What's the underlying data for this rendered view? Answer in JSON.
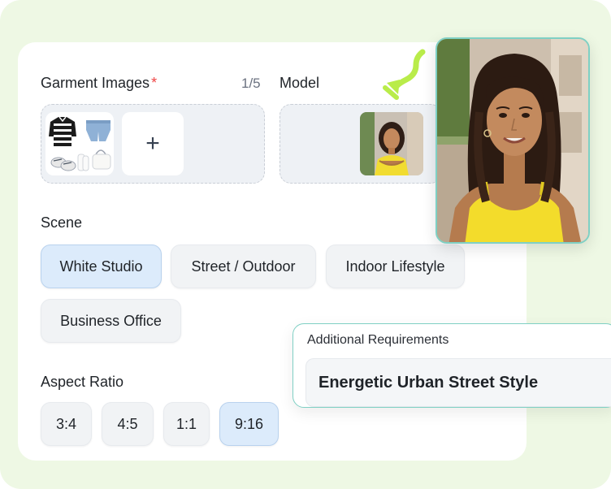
{
  "garment": {
    "label": "Garment Images",
    "required_mark": "*",
    "count": "1/5",
    "add_symbol": "+"
  },
  "model": {
    "label": "Model"
  },
  "scene": {
    "label": "Scene",
    "options": [
      "White Studio",
      "Street / Outdoor",
      "Indoor Lifestyle",
      "Business Office"
    ],
    "selected": "White Studio"
  },
  "aspect": {
    "label": "Aspect Ratio",
    "options": [
      "3:4",
      "4:5",
      "1:1",
      "9:16"
    ],
    "selected": "9:16"
  },
  "requirements": {
    "label": "Additional Requirements",
    "value": "Energetic Urban Street Style"
  },
  "colors": {
    "background_green": "#eef8e4",
    "accent_teal": "#7fd0c4",
    "selected_chip": "#dcebfb",
    "arrow_green": "#b9ec4a",
    "required_red": "#ef4444"
  },
  "icons": [
    "plus-icon",
    "curved-arrow-icon"
  ]
}
